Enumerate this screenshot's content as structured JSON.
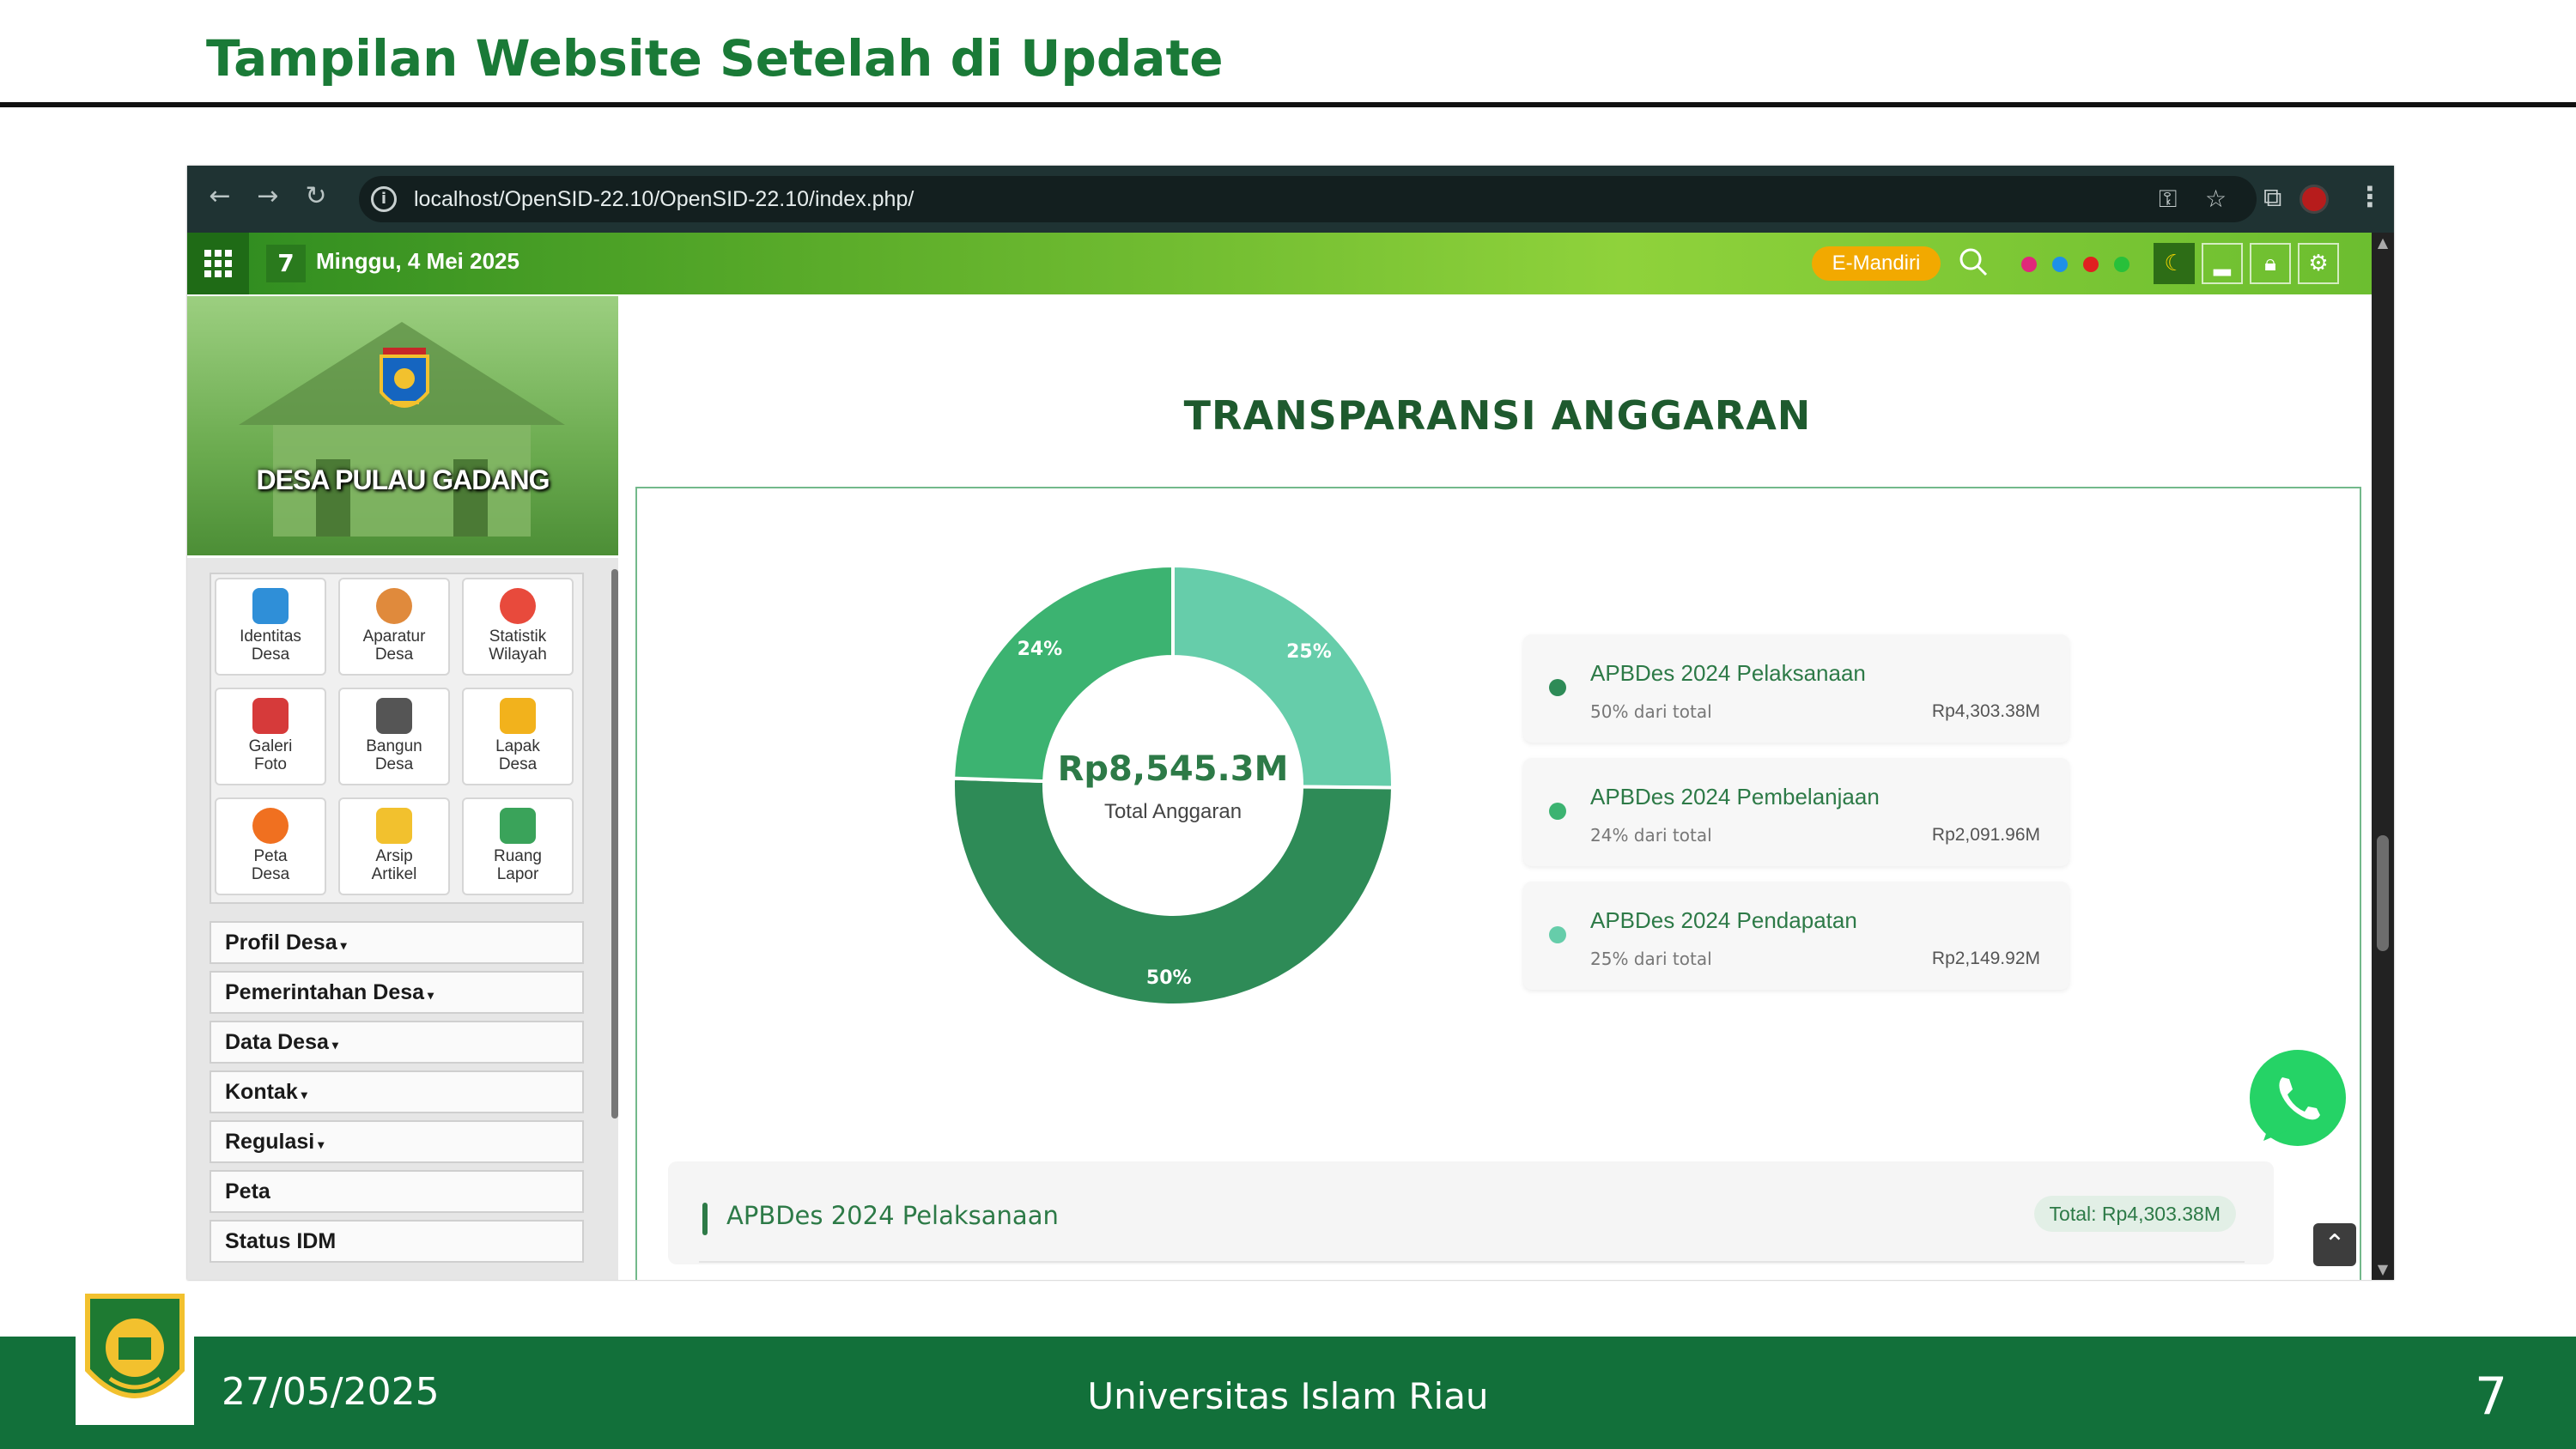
{
  "slide": {
    "title": "Tampilan Website Setelah di Update",
    "footer": {
      "date": "27/05/2025",
      "institution": "Universitas Islam Riau",
      "page_number": "7"
    }
  },
  "browser": {
    "url": "localhost/OpenSID-22.10/OpenSID-22.10/index.php/"
  },
  "site_topbar": {
    "date": "Minggu, 4 Mei 2025",
    "emandiri_label": "E-Mandiri",
    "theme_colors": [
      "#e0287a",
      "#1e90e8",
      "#e02020",
      "#28c03a"
    ]
  },
  "sidebar": {
    "village_name": "DESA PULAU GADANG",
    "tiles": [
      {
        "line1": "Identitas",
        "line2": "Desa",
        "icon": "chat-bubbles-icon",
        "color": "#2f8fd8"
      },
      {
        "line1": "Aparatur",
        "line2": "Desa",
        "icon": "person-icon",
        "color": "#e08a3c"
      },
      {
        "line1": "Statistik",
        "line2": "Wilayah",
        "icon": "pie-chart-icon",
        "color": "#e84a3c"
      },
      {
        "line1": "Galeri",
        "line2": "Foto",
        "icon": "camera-icon",
        "color": "#d63a3a"
      },
      {
        "line1": "Bangun",
        "line2": "Desa",
        "icon": "tools-icon",
        "color": "#555555"
      },
      {
        "line1": "Lapak",
        "line2": "Desa",
        "icon": "basket-icon",
        "color": "#f2b21c"
      },
      {
        "line1": "Peta",
        "line2": "Desa",
        "icon": "map-pin-icon",
        "color": "#f07020"
      },
      {
        "line1": "Arsip",
        "line2": "Artikel",
        "icon": "folder-icon",
        "color": "#f2c12e"
      },
      {
        "line1": "Ruang",
        "line2": "Lapor",
        "icon": "megaphone-icon",
        "color": "#3aa35a"
      }
    ],
    "menu": [
      {
        "label": "Profil Desa",
        "dropdown": true
      },
      {
        "label": "Pemerintahan Desa",
        "dropdown": true
      },
      {
        "label": "Data Desa",
        "dropdown": true
      },
      {
        "label": "Kontak",
        "dropdown": true
      },
      {
        "label": "Regulasi",
        "dropdown": true
      },
      {
        "label": "Peta",
        "dropdown": false
      },
      {
        "label": "Status IDM",
        "dropdown": false
      }
    ]
  },
  "main": {
    "section_title": "TRANSPARANSI ANGGARAN",
    "donut_center_value": "Rp8,545.3M",
    "donut_center_label": "Total Anggaran",
    "legend": [
      {
        "title": "APBDes 2024 Pelaksanaan",
        "pct": "50% dari total",
        "amount": "Rp4,303.38M",
        "color": "#2e8b57"
      },
      {
        "title": "APBDes 2024 Pembelanjaan",
        "pct": "24% dari total",
        "amount": "Rp2,091.96M",
        "color": "#3cb371"
      },
      {
        "title": "APBDes 2024 Pendapatan",
        "pct": "25% dari total",
        "amount": "Rp2,149.92M",
        "color": "#66cdaa"
      }
    ],
    "detail": {
      "title": "APBDes 2024 Pelaksanaan",
      "total": "Total: Rp4,303.38M"
    }
  },
  "chart_data": {
    "type": "pie",
    "categories": [
      "APBDes 2024 Pendapatan",
      "APBDes 2024 Pelaksanaan",
      "APBDes 2024 Pembelanjaan"
    ],
    "values": [
      2149.92,
      4303.38,
      2091.96
    ],
    "labels": [
      "25%",
      "50%",
      "24%"
    ],
    "colors": [
      "#66cdaa",
      "#2e8b57",
      "#3cb371"
    ],
    "donut": true
  }
}
